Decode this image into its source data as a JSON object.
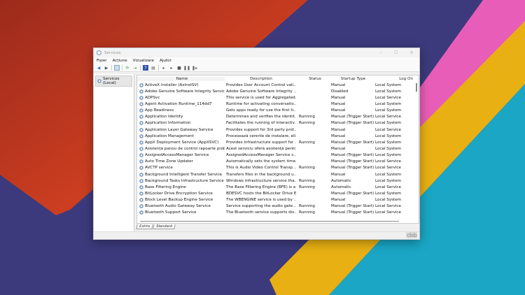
{
  "window": {
    "title": "Services",
    "minimize": "–",
    "maximize": "☐",
    "close": "✕"
  },
  "menu": [
    "Fișier",
    "Acțiune",
    "Vizualizare",
    "Ajutor"
  ],
  "tree": {
    "selected": "Services (Local)"
  },
  "columns": {
    "name": "Name",
    "description": "Description",
    "status": "Status",
    "startup": "Startup Type",
    "logon": "Log On"
  },
  "services": [
    {
      "name": "ActiveX Installer (AxInstSV)",
      "description": "Provides User Account Control vali...",
      "status": "",
      "startup": "Manual",
      "logon": "Local System"
    },
    {
      "name": "Adobe Genuine Software Integrity Service",
      "description": "Adobe Genuine Software Integrity ...",
      "status": "",
      "startup": "Disabled",
      "logon": "Local System"
    },
    {
      "name": "ADPSvc",
      "description": "This service is used for Aggregated...",
      "status": "",
      "startup": "Manual",
      "logon": "Local Service"
    },
    {
      "name": "Agent Activation Runtime_114dd7",
      "description": "Runtime for activating conversatio...",
      "status": "",
      "startup": "Manual",
      "logon": "Local System"
    },
    {
      "name": "App Readiness",
      "description": "Gets apps ready for use the first ti...",
      "status": "",
      "startup": "Manual",
      "logon": "Local System"
    },
    {
      "name": "Application Identity",
      "description": "Determines and verifies the identit...",
      "status": "Running",
      "startup": "Manual (Trigger Start)",
      "logon": "Local Service"
    },
    {
      "name": "Application Information",
      "description": "Facilitates the running of interactiv...",
      "status": "Running",
      "startup": "Manual (Trigger Start)",
      "logon": "Local System"
    },
    {
      "name": "Application Layer Gateway Service",
      "description": "Provides support for 3rd party prot...",
      "status": "",
      "startup": "Manual",
      "logon": "Local Service"
    },
    {
      "name": "Application Management",
      "description": "Procesează cererile de instalare, eli...",
      "status": "",
      "startup": "Manual",
      "logon": "Local System"
    },
    {
      "name": "AppX Deployment Service (AppXSVC)",
      "description": "Provides infrastructure support for ...",
      "status": "Running",
      "startup": "Manual (Trigger Start)",
      "logon": "Local System"
    },
    {
      "name": "Asistență panou de control rapoarte proble...",
      "description": "Acest serviciu oferă asistență pentr...",
      "status": "",
      "startup": "Manual",
      "logon": "Local System"
    },
    {
      "name": "AssignedAccessManager Service",
      "description": "AssignedAccessManager Service s...",
      "status": "",
      "startup": "Manual (Trigger Start)",
      "logon": "Local System"
    },
    {
      "name": "Auto Time Zone Updater",
      "description": "Automatically sets the system time...",
      "status": "",
      "startup": "Manual (Trigger Start)",
      "logon": "Local Service"
    },
    {
      "name": "AVCTP service",
      "description": "This is Audio Video Control Transp...",
      "status": "Running",
      "startup": "Manual (Trigger Start)",
      "logon": "Local Service"
    },
    {
      "name": "Background Intelligent Transfer Service",
      "description": "Transfers files in the background u...",
      "status": "",
      "startup": "Manual",
      "logon": "Local System"
    },
    {
      "name": "Background Tasks Infrastructure Service",
      "description": "Windows infrastructure service tha...",
      "status": "Running",
      "startup": "Automatic",
      "logon": "Local System"
    },
    {
      "name": "Base Filtering Engine",
      "description": "The Base Filtering Engine (BFE) is a ...",
      "status": "Running",
      "startup": "Automatic",
      "logon": "Local Service"
    },
    {
      "name": "BitLocker Drive Encryption Service",
      "description": "BDESVC hosts the BitLocker Drive E...",
      "status": "",
      "startup": "Manual (Trigger Start)",
      "logon": "Local System"
    },
    {
      "name": "Block Level Backup Engine Service",
      "description": "The WBENGINE service is used by ...",
      "status": "",
      "startup": "Manual",
      "logon": "Local System"
    },
    {
      "name": "Bluetooth Audio Gateway Service",
      "description": "Service supporting the audio gate...",
      "status": "Running",
      "startup": "Manual (Trigger Start)",
      "logon": "Local Service"
    },
    {
      "name": "Bluetooth Support Service",
      "description": "The Bluetooth service supports dis...",
      "status": "Running",
      "startup": "Manual (Trigger Start)",
      "logon": "Local Service"
    }
  ],
  "tabs": [
    "Extins",
    "Standard"
  ],
  "watermark": "clsb"
}
